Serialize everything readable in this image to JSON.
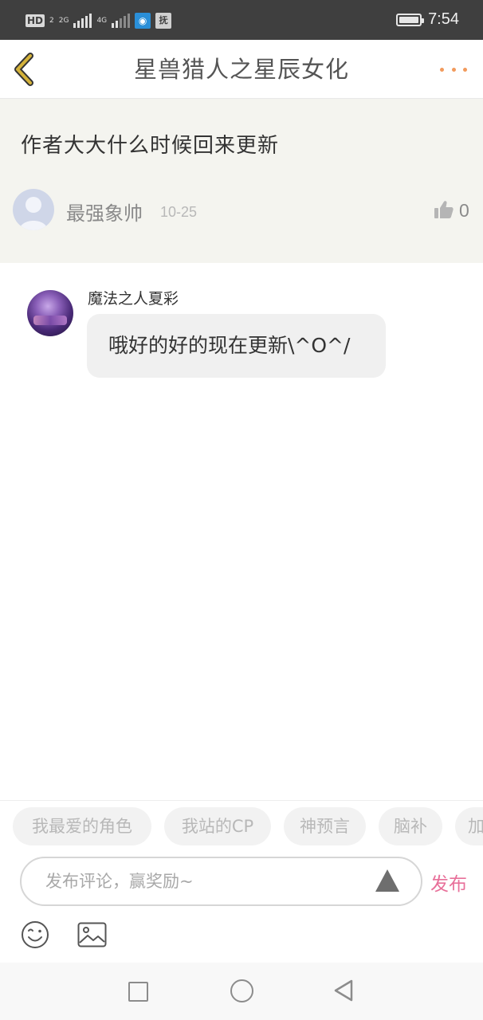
{
  "status_bar": {
    "hd_label": "HD",
    "hd_sub": "2",
    "net_2g": "2G",
    "net_4g": "4G",
    "app_icon_char": "抚",
    "time": "7:54",
    "battery_level": 1.0
  },
  "header": {
    "title": "星兽猎人之星辰女化",
    "back_icon": "chevron-left-icon",
    "more_icon": "more-dots-icon",
    "accent_color": "#d4b23a",
    "more_color": "#f29a5c"
  },
  "post": {
    "text": "作者大大什么时候回来更新",
    "author": "最强象帅",
    "date": "10-25",
    "likes": "0"
  },
  "reply": {
    "author": "魔法之人夏彩",
    "text": "哦好的好的现在更新\\^O^/"
  },
  "tags": [
    "我最爱的角色",
    "我站的CP",
    "神预言",
    "脑补",
    "加"
  ],
  "composer": {
    "placeholder": "发布评论，赢奖励~",
    "publish_label": "发布",
    "publish_color": "#e8709a"
  }
}
